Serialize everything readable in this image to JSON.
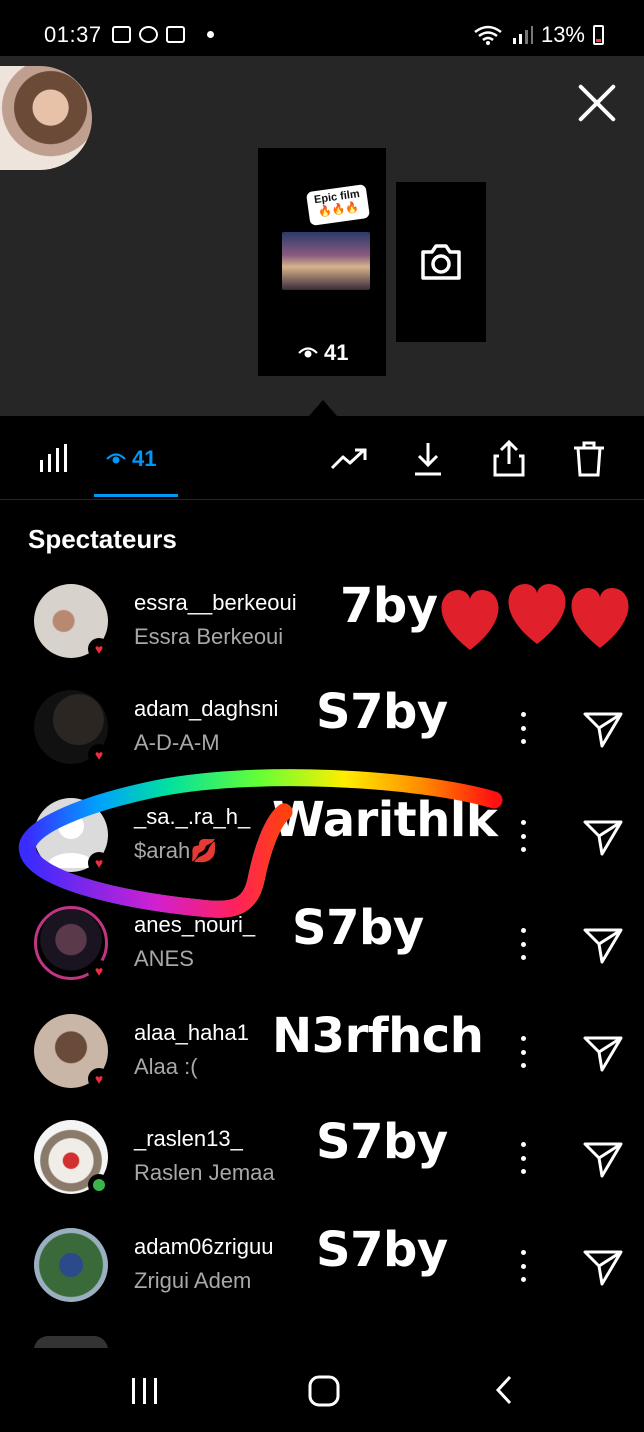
{
  "status_bar": {
    "time": "01:37",
    "battery": "13%"
  },
  "story": {
    "sticker_line1": "Epic film",
    "sticker_line2": "🔥🔥🔥",
    "views": "41"
  },
  "toolbar": {
    "views_count": "41"
  },
  "section_title": "Spectateurs",
  "viewers": [
    {
      "username": "essra__berkeoui",
      "fullname": "Essra Berkeoui",
      "overlay": "7by",
      "badge": "heart"
    },
    {
      "username": "adam_daghsni",
      "fullname": "A-D-A-M",
      "overlay": "S7by",
      "badge": "heart"
    },
    {
      "username": "_sa._.ra_h_",
      "fullname": "$arah💋",
      "overlay": "Warithlk",
      "badge": "heart"
    },
    {
      "username": "anes_nouri_",
      "fullname": "ANES",
      "overlay": "S7by",
      "badge": "heart"
    },
    {
      "username": "alaa_haha1",
      "fullname": "Alaa :(",
      "overlay": "N3rfhch",
      "badge": "heart"
    },
    {
      "username": "_raslen13_",
      "fullname": "Raslen Jemaa",
      "overlay": "S7by",
      "badge": "online"
    },
    {
      "username": "adam06zriguu",
      "fullname": "Zrigui Adem",
      "overlay": "S7by",
      "badge": "none"
    }
  ],
  "colors": {
    "accent": "#0095f6",
    "heart": "#ed2d3e",
    "online": "#3bb54a",
    "secondary_text": "#a8a8a8"
  }
}
